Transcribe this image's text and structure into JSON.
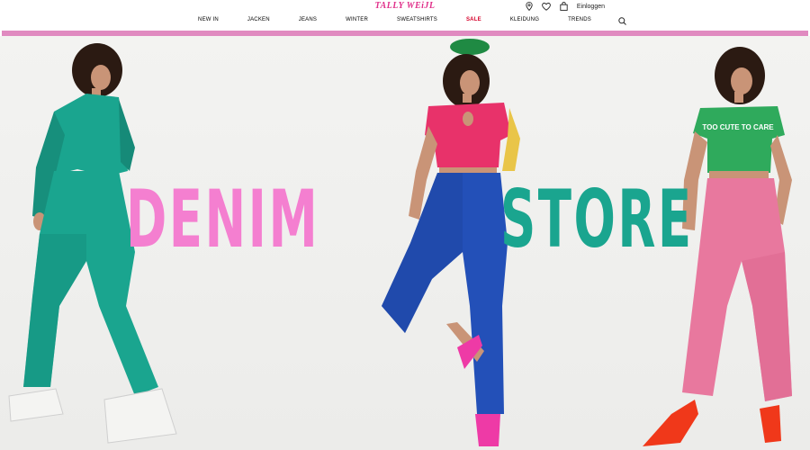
{
  "header": {
    "logo": "TALLY WEiJL",
    "login_label": "Einloggen",
    "icons": [
      "location-pin-icon",
      "heart-icon",
      "shopping-bag-icon",
      "search-icon"
    ],
    "nav": [
      "NEW IN",
      "JACKEN",
      "JEANS",
      "WINTER",
      "SWEATSHIRTS",
      "SALE",
      "KLEIDUNG",
      "TRENDS"
    ],
    "sale_index": 5
  },
  "hero": {
    "word_left": "DENIM",
    "word_right": "STORE",
    "tshirt_print": "TOO CUTE TO CARE"
  },
  "colors": {
    "brand_pink": "#e0308a",
    "stripe_pink": "#e08ac0",
    "sale_red": "#d6002a",
    "denim_pink_text": "#f47fd0",
    "store_teal_text": "#1aa58f",
    "teal_outfit": "#1aa58f",
    "blue_jeans": "#2350b8",
    "pink_jeans": "#e8789e",
    "crop_top_pink": "#e8326a",
    "green_tee": "#2faa5c"
  }
}
